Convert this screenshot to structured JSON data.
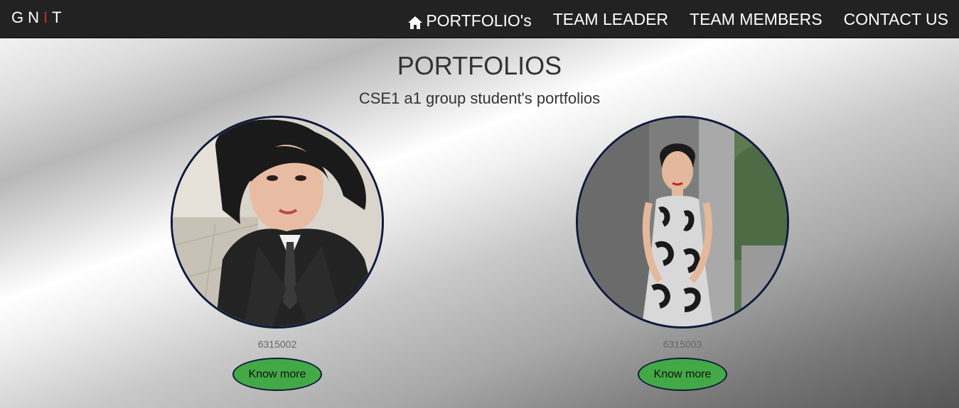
{
  "brand": {
    "letters": [
      "G",
      "N",
      "I",
      "T"
    ],
    "accent_letter": "I",
    "accent_color": "#c62828"
  },
  "nav": {
    "portfolio": "PORTFOLIO's",
    "team_leader": "TEAM LEADER",
    "team_members": "TEAM MEMBERS",
    "contact_us": "CONTACT US",
    "home_icon": "home-icon"
  },
  "header": {
    "title": "PORTFOLIOS",
    "subtitle": "CSE1 a1 group student's portfolios"
  },
  "cards": [
    {
      "id": "6315002",
      "button": "Know more"
    },
    {
      "id": "6315003",
      "button": "Know more"
    }
  ],
  "colors": {
    "navbar": "#222222",
    "button": "#43a946",
    "ring": "#0d1b3d"
  }
}
